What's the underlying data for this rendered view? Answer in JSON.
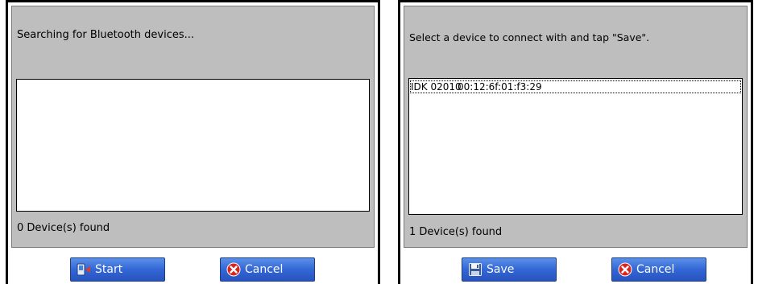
{
  "search_dialog": {
    "prompt": "Searching for Bluetooth devices...",
    "status": "0 Device(s) found",
    "devices": [],
    "start_label": "Start",
    "cancel_label": "Cancel"
  },
  "select_dialog": {
    "prompt": "Select a device to connect with and tap \"Save\".",
    "status": "1 Device(s) found",
    "devices": [
      {
        "name": "IDK 02010",
        "address": "00:12:6f:01:f3:29"
      }
    ],
    "save_label": "Save",
    "cancel_label": "Cancel"
  },
  "colors": {
    "panel_gray": "#bebebe",
    "button_blue": "#3366d6",
    "cancel_red": "#d9251d"
  },
  "icons": {
    "start": "device-bluetooth-icon",
    "save": "floppy-disk-icon",
    "cancel": "red-x-circle-icon"
  }
}
